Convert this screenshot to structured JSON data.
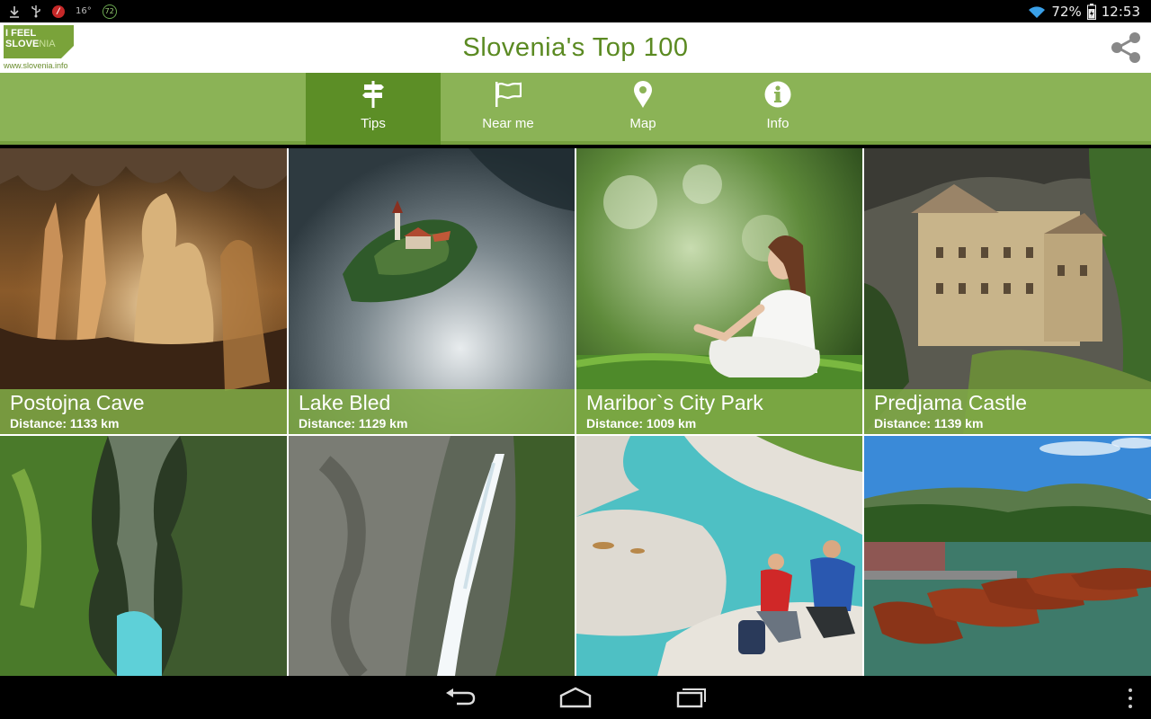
{
  "status_bar": {
    "download_icon": "download-icon",
    "usb_icon": "usb-icon",
    "notification_icon": "red-circle-icon",
    "temp_left": "16°",
    "circle_badge": "72",
    "battery_percent": "72%",
    "time": "12:53"
  },
  "header": {
    "logo_line1": "I FEEL",
    "logo_line2_a": "SLOVE",
    "logo_line2_b": "NIA",
    "logo_url": "www.slovenia.info",
    "title": "Slovenia's Top 100",
    "share_icon": "share-icon"
  },
  "tabs": [
    {
      "label": "Tips",
      "icon": "signpost-icon",
      "active": true
    },
    {
      "label": "Near me",
      "icon": "flag-icon",
      "active": false
    },
    {
      "label": "Map",
      "icon": "map-pin-icon",
      "active": false
    },
    {
      "label": "Info",
      "icon": "info-icon",
      "active": false
    }
  ],
  "tiles": [
    {
      "title": "Postojna Cave",
      "distance": "Distance: 1133 km"
    },
    {
      "title": "Lake Bled",
      "distance": "Distance: 1129 km"
    },
    {
      "title": "Maribor`s City Park",
      "distance": "Distance: 1009 km"
    },
    {
      "title": "Predjama Castle",
      "distance": "Distance: 1139 km"
    },
    {
      "title": "",
      "distance": ""
    },
    {
      "title": "",
      "distance": ""
    },
    {
      "title": "",
      "distance": ""
    },
    {
      "title": "",
      "distance": ""
    }
  ],
  "nav": {
    "back_icon": "back-icon",
    "home_icon": "home-icon",
    "recents_icon": "recents-icon",
    "menu_icon": "overflow-menu-icon"
  }
}
